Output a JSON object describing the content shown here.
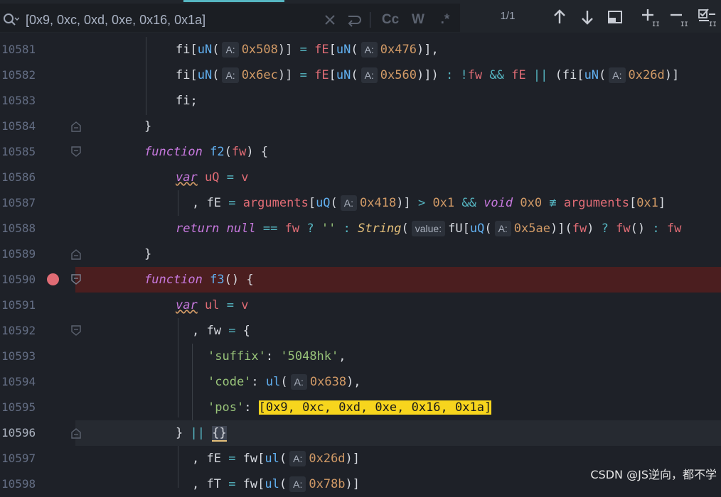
{
  "search": {
    "query": "[0x9, 0xc, 0xd, 0xe, 0x16, 0x1a]",
    "match_case": "Cc",
    "whole_word": "W",
    "regex": ".*",
    "count": "1/1"
  },
  "lines": [
    {
      "num": "10581"
    },
    {
      "num": "10582"
    },
    {
      "num": "10583"
    },
    {
      "num": "10584"
    },
    {
      "num": "10585"
    },
    {
      "num": "10586"
    },
    {
      "num": "10587"
    },
    {
      "num": "10588"
    },
    {
      "num": "10589"
    },
    {
      "num": "10590"
    },
    {
      "num": "10591"
    },
    {
      "num": "10592"
    },
    {
      "num": "10593"
    },
    {
      "num": "10594"
    },
    {
      "num": "10595"
    },
    {
      "num": "10596"
    },
    {
      "num": "10597"
    },
    {
      "num": "10598"
    }
  ],
  "hint": {
    "a": "A:",
    "value": "value:"
  },
  "watermark": "CSDN @JS逆向，都不学"
}
